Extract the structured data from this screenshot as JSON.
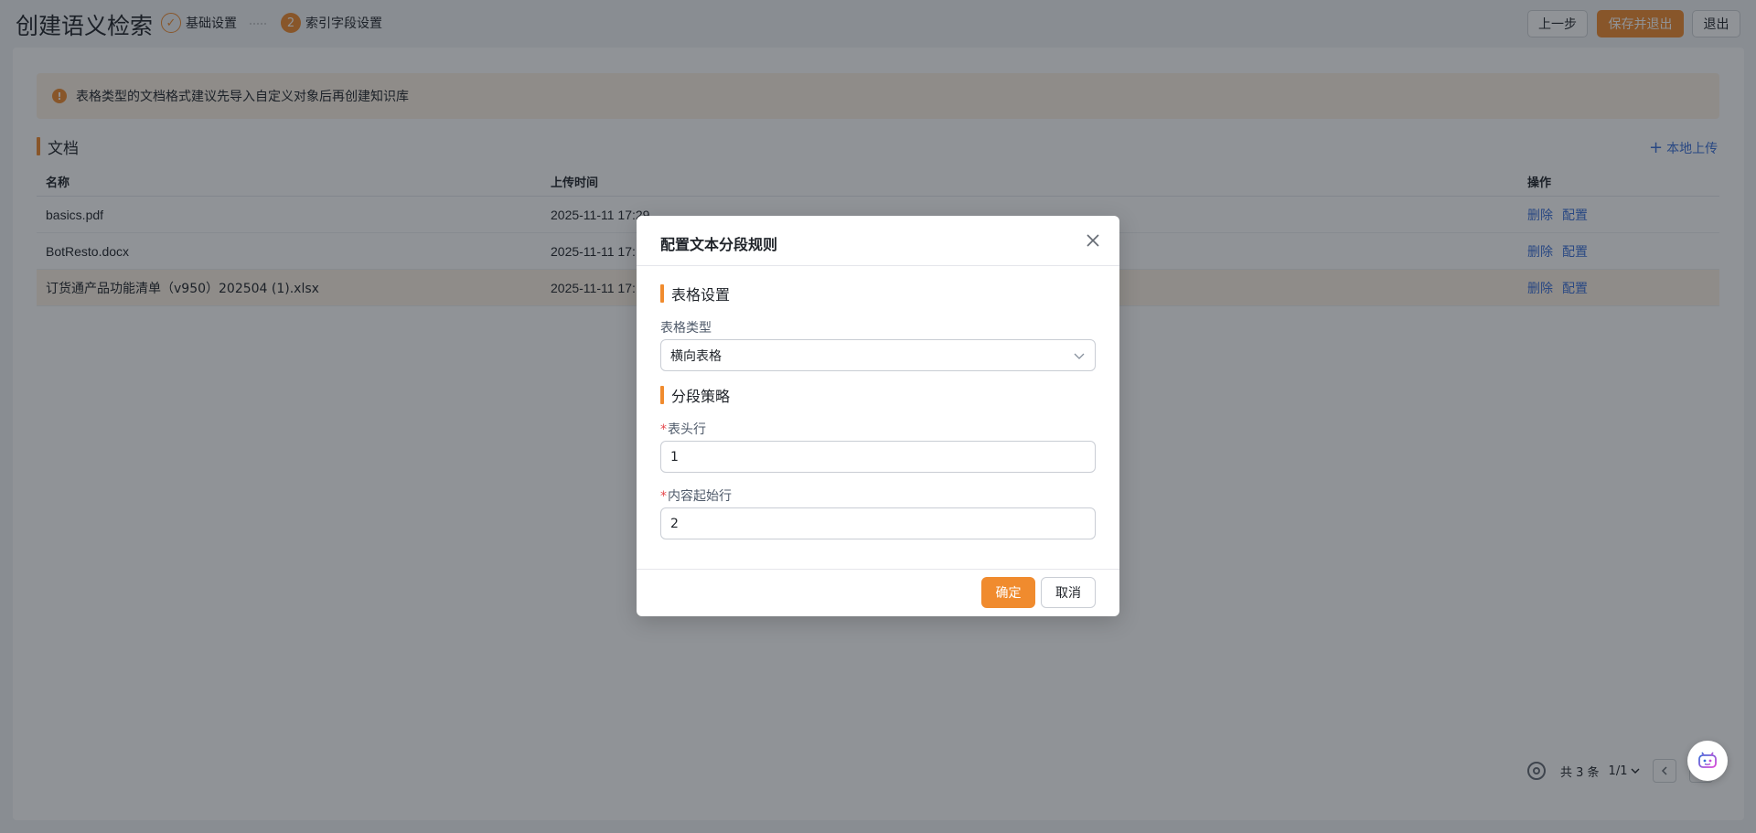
{
  "header": {
    "title": "创建语义检索",
    "steps": [
      {
        "label": "基础设置",
        "marker": "✓",
        "status": "done"
      },
      {
        "label": "索引字段设置",
        "marker": "2",
        "status": "active"
      }
    ],
    "buttons": {
      "prev": "上一步",
      "save_exit": "保存并退出",
      "exit": "退出"
    }
  },
  "alert": {
    "icon": "!",
    "text": "表格类型的文档格式建议先导入自定义对象后再创建知识库"
  },
  "documents": {
    "section_title": "文档",
    "upload_label": "本地上传",
    "columns": [
      "名称",
      "上传时间",
      "操作"
    ],
    "rows": [
      {
        "name": "basics.pdf",
        "time": "2025-11-11 17:29",
        "delete": "删除",
        "config": "配置"
      },
      {
        "name": "BotResto.docx",
        "time": "2025-11-11 17:",
        "delete": "删除",
        "config": "配置"
      },
      {
        "name": "订货通产品功能清单（v950）202504 (1).xlsx",
        "time": "2025-11-11 17:",
        "delete": "删除",
        "config": "配置"
      }
    ]
  },
  "pagination": {
    "total": "共 3 条",
    "page": "1/1"
  },
  "modal": {
    "title": "配置文本分段规则",
    "table_section": "表格设置",
    "table_type_label": "表格类型",
    "table_type_value": "横向表格",
    "strategy_section": "分段策略",
    "header_row_label": "表头行",
    "header_row_value": "1",
    "content_start_label": "内容起始行",
    "content_start_value": "2",
    "required_mark": "*",
    "ok": "确定",
    "cancel": "取消"
  },
  "colors": {
    "accent": "#f08b2e",
    "link": "#3a6fd8",
    "highlight_row": "#fdf2e4"
  }
}
